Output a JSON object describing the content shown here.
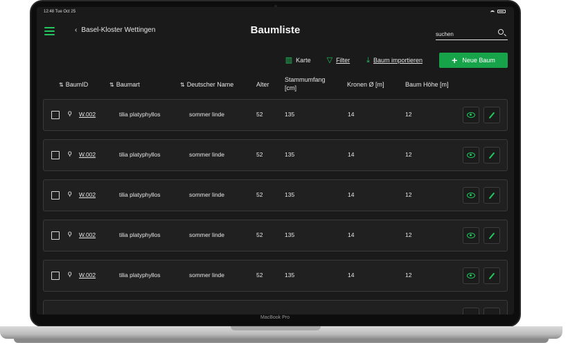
{
  "device": {
    "model_label": "MacBook Pro"
  },
  "status_bar": {
    "time": "12:48",
    "date": "Tue Oct 25"
  },
  "header": {
    "back_label": "Basel-Kloster Wettingen",
    "title": "Baumliste",
    "search_placeholder": "suchen"
  },
  "toolbar": {
    "karte_label": "Karte",
    "filter_label": "Filter",
    "import_label": "Baum importieren",
    "new_label": "Neue Baum",
    "accent_color": "#22c55e"
  },
  "columns": {
    "id": "BaumID",
    "art": "Baumart",
    "name": "Deutscher Name",
    "alter": "Alter",
    "umfang": "Stammumfang [cm]",
    "kronen": "Kronen Ø [m]",
    "hoehe": "Baum Höhe [m]"
  },
  "rows": [
    {
      "id": "W.002",
      "art": "tilia platyphyllos",
      "name": "sommer linde",
      "alter": "52",
      "umfang": "135",
      "kronen": "14",
      "hoehe": "12"
    },
    {
      "id": "W.002",
      "art": "tilia platyphyllos",
      "name": "sommer linde",
      "alter": "52",
      "umfang": "135",
      "kronen": "14",
      "hoehe": "12"
    },
    {
      "id": "W.002",
      "art": "tilia platyphyllos",
      "name": "sommer linde",
      "alter": "52",
      "umfang": "135",
      "kronen": "14",
      "hoehe": "12"
    },
    {
      "id": "W.002",
      "art": "tilia platyphyllos",
      "name": "sommer linde",
      "alter": "52",
      "umfang": "135",
      "kronen": "14",
      "hoehe": "12"
    },
    {
      "id": "W.002",
      "art": "tilia platyphyllos",
      "name": "sommer linde",
      "alter": "52",
      "umfang": "135",
      "kronen": "14",
      "hoehe": "12"
    }
  ]
}
